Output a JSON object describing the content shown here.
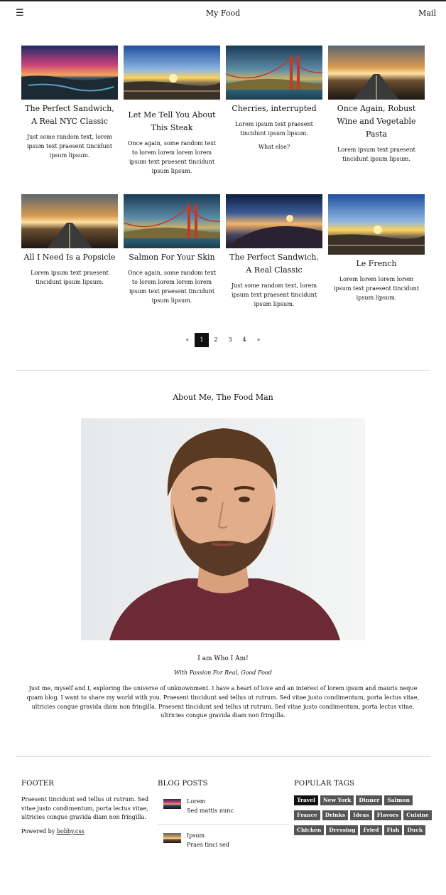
{
  "header": {
    "menu_icon": "hamburger-icon",
    "title": "My Food",
    "mail_label": "Mail"
  },
  "posts": [
    {
      "title": "The Perfect Sandwich, A Real NYC Classic",
      "text": "Just some random text, lorem ipsum text praesent tincidunt ipsum lipsum."
    },
    {
      "title": "Let Me Tell You About This Steak",
      "text": "Once again, some random text to lorem lorem lorem lorem ipsum text praesent tincidunt ipsum lipsum."
    },
    {
      "title": "Cherries, interrupted",
      "text": "Lorem ipsum text praesent tincidunt ipsum lipsum.",
      "extra": "What else?"
    },
    {
      "title": "Once Again, Robust Wine and Vegetable Pasta",
      "text": "Lorem ipsum text praesent tincidunt ipsum lipsum."
    },
    {
      "title": "All I Need Is a Popsicle",
      "text": "Lorem ipsum text praesent tincidunt ipsum lipsum."
    },
    {
      "title": "Salmon For Your Skin",
      "text": "Once again, some random text to lorem lorem lorem lorem ipsum text praesent tincidunt ipsum lipsum."
    },
    {
      "title": "The Perfect Sandwich, A Real Classic",
      "text": "Just some random text, lorem ipsum text praesent tincidunt ipsum lipsum."
    },
    {
      "title": "Le French",
      "text": "Lorem lorem lorem lorem ipsum text praesent tincidunt ipsum lipsum."
    }
  ],
  "pagination": {
    "prev": "«",
    "pages": [
      "1",
      "2",
      "3",
      "4"
    ],
    "active": "1",
    "next": "»"
  },
  "about": {
    "title": "About Me, The Food Man",
    "name": "I am Who I Am!",
    "tagline": "With Passion For Real, Good Food",
    "body": "Just me, myself and I, exploring the universe of unknownment. I have a heart of love and an interest of lorem ipsum and mauris neque quam blog. I want to share my world with you. Praesent tincidunt sed tellus ut rutrum. Sed vitae justo condimentum, porta lectus vitae, ultricies congue gravida diam non fringilla. Praesent tincidunt sed tellus ut rutrum. Sed vitae justo condimentum, porta lectus vitae, ultricies congue gravida diam non fringilla."
  },
  "footer": {
    "heading": "FOOTER",
    "text": "Praesent tincidunt sed tellus ut rutrum. Sed vitae justo condimentum, porta lectus vitae, ultricies congue gravida diam non fringilla.",
    "powered_prefix": "Powered by",
    "powered_link": "bobby.css"
  },
  "blog_posts": {
    "heading": "BLOG POSTS",
    "items": [
      {
        "title": "Lorem",
        "subtitle": "Sed mattis nunc"
      },
      {
        "title": "Ipsum",
        "subtitle": "Praes tinci sed"
      }
    ]
  },
  "popular_tags": {
    "heading": "POPULAR TAGS",
    "rows": [
      [
        "Travel",
        "New York",
        "Dinner",
        "Salmon"
      ],
      [
        "France",
        "Drinks",
        "Ideas",
        "Flavors",
        "Cuisine"
      ],
      [
        "Chicken",
        "Dressing",
        "Fried",
        "Fish",
        "Duck"
      ]
    ],
    "active": "Travel"
  }
}
